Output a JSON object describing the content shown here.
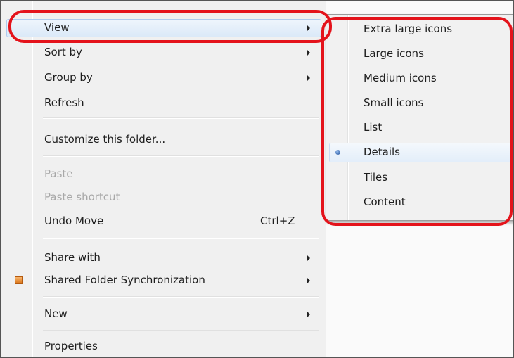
{
  "context_menu": {
    "items": [
      {
        "label": "View",
        "submenu": true,
        "highlighted": true
      },
      {
        "label": "Sort by",
        "submenu": true
      },
      {
        "label": "Group by",
        "submenu": true
      },
      {
        "label": "Refresh"
      },
      {
        "label": "Customize this folder..."
      },
      {
        "label": "Paste",
        "disabled": true
      },
      {
        "label": "Paste shortcut",
        "disabled": true
      },
      {
        "label": "Undo Move",
        "shortcut": "Ctrl+Z"
      },
      {
        "label": "Share with",
        "submenu": true
      },
      {
        "label": "Shared Folder Synchronization",
        "submenu": true,
        "icon": "sync-folder-icon"
      },
      {
        "label": "New",
        "submenu": true
      },
      {
        "label": "Properties"
      }
    ]
  },
  "view_submenu": {
    "items": [
      {
        "label": "Extra large icons"
      },
      {
        "label": "Large icons"
      },
      {
        "label": "Medium icons"
      },
      {
        "label": "Small icons"
      },
      {
        "label": "List"
      },
      {
        "label": "Details",
        "selected": true,
        "icon": "radio-bullet-icon"
      },
      {
        "label": "Tiles"
      },
      {
        "label": "Content"
      }
    ]
  },
  "annotations": {
    "color": "#e4131b",
    "targets": [
      "View menu item",
      "View submenu"
    ]
  }
}
